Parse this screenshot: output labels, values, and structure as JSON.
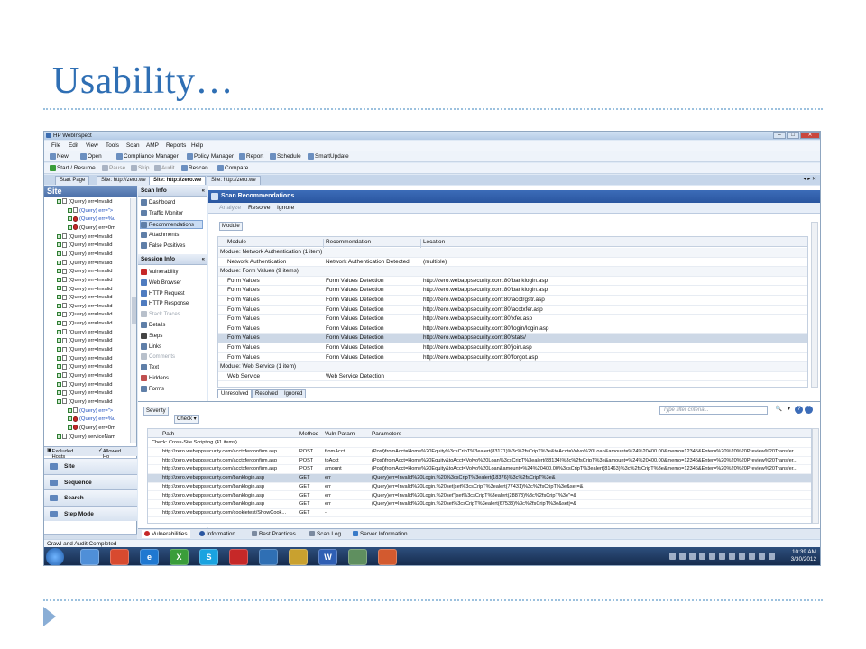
{
  "slide": {
    "title": "Usability…"
  },
  "window": {
    "title": "HP WebInspect"
  },
  "menu": [
    "File",
    "Edit",
    "View",
    "Tools",
    "Scan",
    "AMP",
    "Reports",
    "Help"
  ],
  "toolbar1": {
    "new": "New",
    "open": "Open",
    "compliance": "Compliance Manager",
    "policy": "Policy Manager",
    "report": "Report",
    "schedule": "Schedule",
    "smartupdate": "SmartUpdate"
  },
  "toolbar2": {
    "start": "Start / Resume",
    "pause": "Pause",
    "skip": "Skip",
    "audit": "Audit",
    "rescan": "Rescan",
    "compare": "Compare"
  },
  "tabs": [
    "Start Page",
    "Site: http://zero.we",
    "Site: http://zero.we",
    "Site: http://zero.we"
  ],
  "site": {
    "title": "Site",
    "tree": [
      {
        "text": "(Query) err=Invalid",
        "blue": false,
        "red": false,
        "indent": 0
      },
      {
        "text": "(Query) err=\">",
        "blue": true,
        "red": false,
        "indent": 1
      },
      {
        "text": "(Query) err=%u",
        "blue": true,
        "red": true,
        "indent": 1
      },
      {
        "text": "(Query) err=0m",
        "blue": false,
        "red": true,
        "indent": 1
      },
      {
        "text": "(Query) err=Invalid",
        "blue": false,
        "red": false,
        "indent": 0
      },
      {
        "text": "(Query) err=Invalid",
        "blue": false,
        "red": false,
        "indent": 0
      },
      {
        "text": "(Query) err=Invalid",
        "blue": false,
        "red": false,
        "indent": 0
      },
      {
        "text": "(Query) err=Invalid",
        "blue": false,
        "red": false,
        "indent": 0
      },
      {
        "text": "(Query) err=Invalid",
        "blue": false,
        "red": false,
        "indent": 0
      },
      {
        "text": "(Query) err=Invalid",
        "blue": false,
        "red": false,
        "indent": 0
      },
      {
        "text": "(Query) err=Invalid",
        "blue": false,
        "red": false,
        "indent": 0
      },
      {
        "text": "(Query) err=Invalid",
        "blue": false,
        "red": false,
        "indent": 0
      },
      {
        "text": "(Query) err=Invalid",
        "blue": false,
        "red": false,
        "indent": 0
      },
      {
        "text": "(Query) err=Invalid",
        "blue": false,
        "red": false,
        "indent": 0
      },
      {
        "text": "(Query) err=Invalid",
        "blue": false,
        "red": false,
        "indent": 0
      },
      {
        "text": "(Query) err=Invalid",
        "blue": false,
        "red": false,
        "indent": 0
      },
      {
        "text": "(Query) err=Invalid",
        "blue": false,
        "red": false,
        "indent": 0
      },
      {
        "text": "(Query) err=Invalid",
        "blue": false,
        "red": false,
        "indent": 0
      },
      {
        "text": "(Query) err=Invalid",
        "blue": false,
        "red": false,
        "indent": 0
      },
      {
        "text": "(Query) err=Invalid",
        "blue": false,
        "red": false,
        "indent": 0
      },
      {
        "text": "(Query) err=Invalid",
        "blue": false,
        "red": false,
        "indent": 0
      },
      {
        "text": "(Query) err=Invalid",
        "blue": false,
        "red": false,
        "indent": 0
      },
      {
        "text": "(Query) err=Invalid",
        "blue": false,
        "red": false,
        "indent": 0
      },
      {
        "text": "(Query) err=Invalid",
        "blue": false,
        "red": false,
        "indent": 0
      },
      {
        "text": "(Query) err=\">",
        "blue": true,
        "red": false,
        "indent": 1
      },
      {
        "text": "(Query) err=%u",
        "blue": true,
        "red": true,
        "indent": 1
      },
      {
        "text": "(Query) err=0m",
        "blue": false,
        "red": true,
        "indent": 1
      },
      {
        "text": "(Query) serviceNam",
        "blue": false,
        "red": false,
        "indent": 0
      }
    ],
    "hosttabs": [
      "Excluded Hosts",
      "Allowed Ho"
    ],
    "nav": [
      "Site",
      "Sequence",
      "Search",
      "Step Mode"
    ]
  },
  "scaninfo": {
    "title": "Scan Info",
    "items": [
      "Dashboard",
      "Traffic Monitor",
      "Recommendations",
      "Attachments",
      "False Positives"
    ]
  },
  "sessioninfo": {
    "title": "Session Info",
    "items": [
      "Vulnerability",
      "Web Browser",
      "HTTP Request",
      "HTTP Response",
      "Stack Traces",
      "Details",
      "Steps",
      "Links",
      "Comments",
      "Text",
      "Hiddens",
      "Forms"
    ]
  },
  "recommendations": {
    "title": "Scan Recommendations",
    "actions": [
      "Analyze",
      "Resolve",
      "Ignore"
    ],
    "group_by": "Module",
    "columns": [
      "Module",
      "Recommendation",
      "Location"
    ],
    "rows": [
      {
        "kind": "group",
        "text": "Module: Network Authentication (1 item)"
      },
      {
        "kind": "row",
        "module": "Network Authentication",
        "rec": "Network Authentication Detected",
        "loc": "(multiple)"
      },
      {
        "kind": "group",
        "text": "Module: Form Values (9 items)"
      },
      {
        "kind": "row",
        "module": "Form Values",
        "rec": "Form Values Detection",
        "loc": "http://zero.webappsecurity.com:80/banklogin.asp"
      },
      {
        "kind": "row",
        "module": "Form Values",
        "rec": "Form Values Detection",
        "loc": "http://zero.webappsecurity.com:80/banklogin.asp"
      },
      {
        "kind": "row",
        "module": "Form Values",
        "rec": "Form Values Detection",
        "loc": "http://zero.webappsecurity.com:80/acctrgstr.asp"
      },
      {
        "kind": "row",
        "module": "Form Values",
        "rec": "Form Values Detection",
        "loc": "http://zero.webappsecurity.com:80/acctxfer.asp"
      },
      {
        "kind": "row",
        "module": "Form Values",
        "rec": "Form Values Detection",
        "loc": "http://zero.webappsecurity.com:80/xfer.asp"
      },
      {
        "kind": "row",
        "module": "Form Values",
        "rec": "Form Values Detection",
        "loc": "http://zero.webappsecurity.com:80/login/login.asp"
      },
      {
        "kind": "selrow",
        "module": "Form Values",
        "rec": "Form Values Detection",
        "loc": "http://zero.webappsecurity.com:80/stats/"
      },
      {
        "kind": "row",
        "module": "Form Values",
        "rec": "Form Values Detection",
        "loc": "http://zero.webappsecurity.com:80/join.asp"
      },
      {
        "kind": "row",
        "module": "Form Values",
        "rec": "Form Values Detection",
        "loc": "http://zero.webappsecurity.com:80/forgot.asp"
      },
      {
        "kind": "group",
        "text": "Module: Web Service (1 item)"
      },
      {
        "kind": "row",
        "module": "Web Service",
        "rec": "Web Service Detection",
        "loc": ""
      }
    ],
    "bottom_tabs": [
      "Unresolved",
      "Resolved",
      "Ignored"
    ]
  },
  "vulns": {
    "severity": "Severity",
    "check": "Check",
    "filter_placeholder": "Type filter criteria...",
    "columns": [
      "Path",
      "Method",
      "Vuln Param",
      "Parameters"
    ],
    "group": "Check: Cross-Site Scripting (41 items)",
    "rows": [
      {
        "path": "http://zero.webappsecurity.com/acctxferconfirm.asp",
        "method": "POST",
        "param": "fromAcct",
        "params": "(Post)fromAcct=Home%20Equity%3csCripT%3ealert(83171)%3c%2fsCripT%3e&toAcct=Volvo%20Loan&amount=%24%20400.00&memo=12345&Enter=%20%20%20Preview%20Transfer..."
      },
      {
        "path": "http://zero.webappsecurity.com/acctxferconfirm.asp",
        "method": "POST",
        "param": "toAcct",
        "params": "(Post)fromAcct=Home%20Equity&toAcct=Volvo%20Loan%3csCripT%3ealert(88134)%3c%2fsCripT%3e&amount=%24%20400.00&memo=12345&Enter=%20%20%20Preview%20Transfer..."
      },
      {
        "path": "http://zero.webappsecurity.com/acctxferconfirm.asp",
        "method": "POST",
        "param": "amount",
        "params": "(Post)fromAcct=Home%20Equity&toAcct=Volvo%20Loan&amount=%24%20400.00%3csCripT%3ealert(81463)%3c%2fsCripT%3e&memo=12345&Enter=%20%20%20Preview%20Transfer..."
      },
      {
        "path": "http://zero.webappsecurity.com/banklogin.asp",
        "method": "GET",
        "param": "err",
        "params": "(Query)err=Invalid%20Login.%20%3csCripT%3ealert(18376)%3c%2fsCripT%3e&",
        "sel": true
      },
      {
        "path": "http://zero.webappsecurity.com/banklogin.asp",
        "method": "GET",
        "param": "err",
        "params": "(Query)err=Invalid%20Login.%20set|set%3csCripT%3ealert(77431)%3c%2fsCripT%3e&set=&"
      },
      {
        "path": "http://zero.webappsecurity.com/banklogin.asp",
        "method": "GET",
        "param": "err",
        "params": "(Query)err=Invalid%20Login.%20set\"|set%3csCripT%3ealert(28873)%3c%2fsCripT%3e\"=&"
      },
      {
        "path": "http://zero.webappsecurity.com/banklogin.asp",
        "method": "GET",
        "param": "err",
        "params": "(Query)err=Invalid%20Login.%20set%3csCripT%3ealert(67533)%3c%2fsCripT%3e&set|=&"
      },
      {
        "path": "http://zero.webappsecurity.com/cookietest/ShowCook...",
        "method": "GET",
        "param": "-",
        "params": ""
      }
    ]
  },
  "bottomtabs": [
    "Vulnerabilities",
    "Information",
    "Best Practices",
    "Scan Log",
    "Server Information"
  ],
  "status": "Crawl and Audit Completed",
  "taskbar": {
    "time": "10:39 AM",
    "date": "3/30/2012",
    "apps": [
      "",
      "",
      "",
      "e",
      "X",
      "S",
      "",
      "",
      "",
      "W",
      "",
      ""
    ]
  },
  "colors": {
    "accent": "#2f6fb4",
    "header_blue": "#2a56a0",
    "selected_row": "#cdd8e6"
  }
}
